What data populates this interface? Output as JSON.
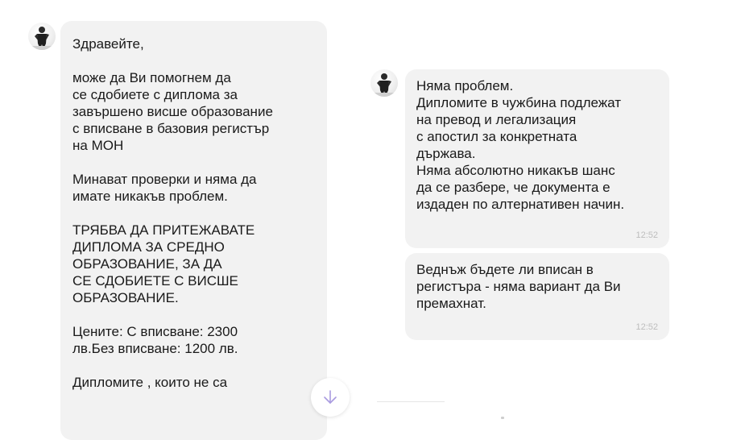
{
  "messages": {
    "left": {
      "text": "Здравейте,\n\nможе да Ви помогнем да\nсе сдобиете с  диплома за\nзавършено висше образование\nс вписване в базовия регистър\nна МОН\n\nМинават проверки и няма да\nимате никакъв проблем.\n\nТРЯБВА ДА ПРИТЕЖАВАТЕ\nДИПЛОМА ЗА СРЕДНО\nОБРАЗОВАНИЕ, ЗА ДА\nСЕ СДОБИЕТЕ С ВИСШЕ\nОБРАЗОВАНИЕ.\n\nЦените:   С вписване: 2300\nлв.Без вписване: 1200  лв.\n\nДипломите , които не са"
    },
    "right_1": {
      "text": "Няма проблем.\nДипломите в чужбина подлежат\nна превод и легализация\nс апостил за конкретната\nдържава.\nНяма абсолютно никакъв шанс\nда се разбере, че документа е\nиздаден по алтернативен начин.",
      "time": "12:52"
    },
    "right_2": {
      "text": "Веднъж бъдете ли вписан в\nрегистъра - няма вариант да Ви\nпремахнат.",
      "time": "12:52"
    }
  },
  "icons": {
    "avatar": "avatar-person-suit",
    "scroll": "arrow-down-icon"
  },
  "colors": {
    "bubble_bg": "#f2f2f2",
    "time_text": "#bdbdbd",
    "scroll_arrow": "#a99be0"
  }
}
